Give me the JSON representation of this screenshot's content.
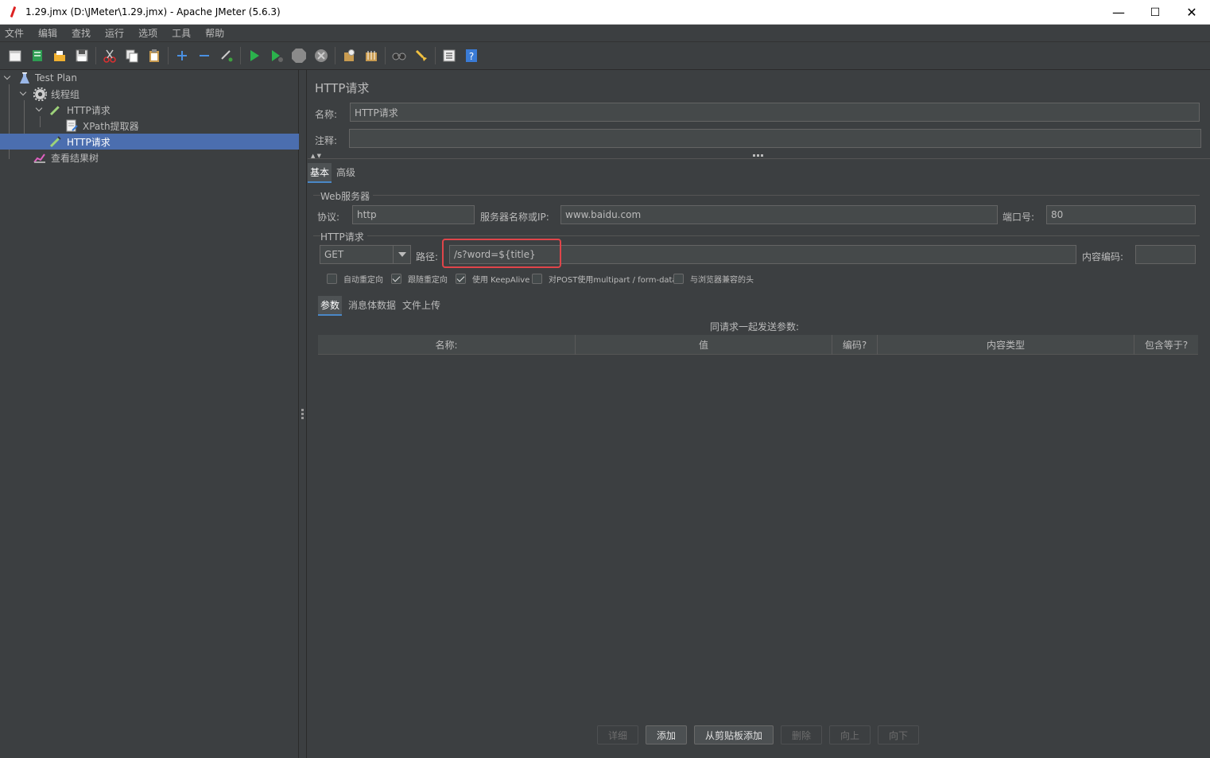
{
  "window": {
    "title": "1.29.jmx (D:\\JMeter\\1.29.jmx) - Apache JMeter (5.6.3)",
    "minimize": "—",
    "maximize": "☐",
    "close": "✕"
  },
  "menu": [
    "文件",
    "编辑",
    "查找",
    "运行",
    "选项",
    "工具",
    "帮助"
  ],
  "tree": {
    "items": [
      {
        "label": "Test Plan"
      },
      {
        "label": "线程组"
      },
      {
        "label": "HTTP请求"
      },
      {
        "label": "XPath提取器"
      },
      {
        "label": "HTTP请求"
      },
      {
        "label": "查看结果树"
      }
    ]
  },
  "panel": {
    "title": "HTTP请求",
    "name_label": "名称:",
    "name_value": "HTTP请求",
    "comment_label": "注释:",
    "comment_value": "",
    "tabs": [
      "基本",
      "高级"
    ]
  },
  "web_server": {
    "group_title": "Web服务器",
    "protocol_label": "协议:",
    "protocol_value": "http",
    "server_label": "服务器名称或IP:",
    "server_value": "www.baidu.com",
    "port_label": "端口号:",
    "port_value": "80"
  },
  "http_request": {
    "group_title": "HTTP请求",
    "method": "GET",
    "path_label": "路径:",
    "path_value": "/s?word=${title}",
    "encoding_label": "内容编码:",
    "encoding_value": "",
    "checkboxes": [
      {
        "label": "自动重定向",
        "checked": false
      },
      {
        "label": "跟随重定向",
        "checked": true
      },
      {
        "label": "使用 KeepAlive",
        "checked": true
      },
      {
        "label": "对POST使用multipart / form-data",
        "checked": false
      },
      {
        "label": "与浏览器兼容的头",
        "checked": false
      }
    ],
    "sub_tabs": [
      "参数",
      "消息体数据",
      "文件上传"
    ]
  },
  "params_table": {
    "caption": "同请求一起发送参数:",
    "columns": [
      "名称:",
      "值",
      "编码?",
      "内容类型",
      "包含等于?"
    ]
  },
  "buttons": [
    "详细",
    "添加",
    "从剪贴板添加",
    "删除",
    "向上",
    "向下"
  ],
  "colors": {
    "highlight": "#e0454a",
    "selection": "#4b6eaf",
    "background": "#3c3f41"
  }
}
